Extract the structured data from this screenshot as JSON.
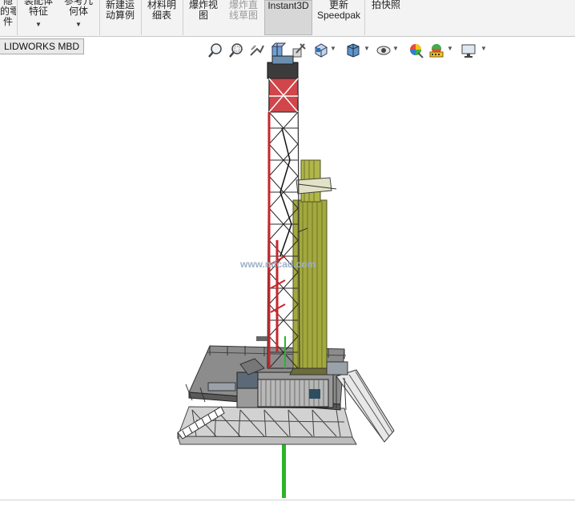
{
  "ribbon": {
    "buttons": [
      {
        "line1": "隐",
        "line2": "的零",
        "line3": "件",
        "state": "normal"
      },
      {
        "line1": "装配体",
        "line2": "特征",
        "line3": "",
        "state": "normal",
        "dropdown": true
      },
      {
        "line1": "参考几",
        "line2": "何体",
        "line3": "",
        "state": "normal",
        "dropdown": true
      },
      {
        "line1": "新建运",
        "line2": "动算例",
        "line3": "",
        "state": "normal"
      },
      {
        "line1": "材料明",
        "line2": "细表",
        "line3": "",
        "state": "normal"
      },
      {
        "line1": "爆炸视",
        "line2": "图",
        "line3": "",
        "state": "normal"
      },
      {
        "line1": "爆炸直",
        "line2": "线草图",
        "line3": "",
        "state": "disabled"
      },
      {
        "line1": "Instant3D",
        "line2": "",
        "line3": "",
        "state": "active"
      },
      {
        "line1": "更新",
        "line2": "Speedpak",
        "line3": "",
        "state": "normal"
      },
      {
        "line1": "拍快照",
        "line2": "",
        "line3": "",
        "state": "normal"
      }
    ]
  },
  "tabs": {
    "mbd_label": "LIDWORKS MBD"
  },
  "heads_up_toolbar": {
    "icons": [
      "zoom-to-fit-icon",
      "zoom-to-area-icon",
      "previous-view-icon",
      "section-view-icon",
      "dynamic-annotation-icon",
      "view-orientation-icon",
      "display-style-icon",
      "hide-show-items-icon",
      "edit-appearance-icon",
      "apply-scene-icon",
      "view-settings-icon"
    ]
  },
  "watermark": {
    "text": "www.mfcad.com"
  },
  "colors": {
    "ribbon_bg": "#f3f3f3",
    "mast_red": "#c8262a",
    "tank_olive": "#9ea33a",
    "axis_green": "#2ab52a"
  }
}
